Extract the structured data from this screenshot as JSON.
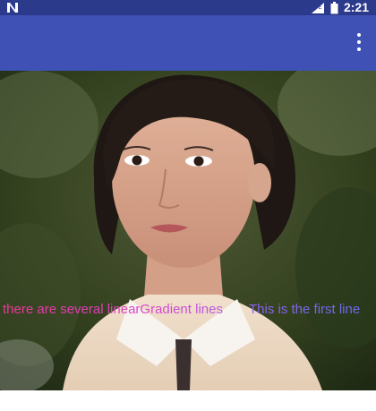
{
  "status_bar": {
    "time": "2:21",
    "left_icon": "n-logo-icon",
    "right_icons": [
      "signal-icon",
      "battery-icon"
    ]
  },
  "app_bar": {
    "menu_icon": "overflow-menu-icon",
    "color": "#3f51b5"
  },
  "content": {
    "image": "portrait-photo",
    "gradient_text_part1": "there are several linearGradient lines",
    "gradient_text_part2": "This is the first line",
    "colors": {
      "gradient_start": "#f0359a",
      "gradient_mid": "#d846d0",
      "gradient_end": "#6e6af2"
    }
  }
}
